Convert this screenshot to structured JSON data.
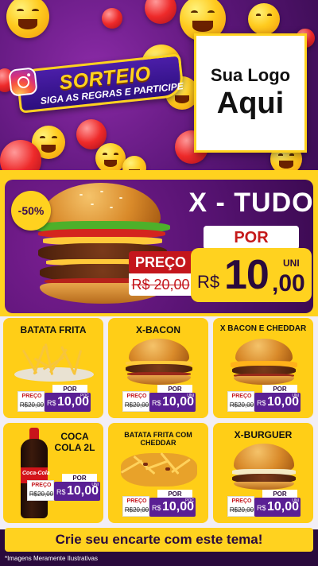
{
  "promo": {
    "title": "SORTEIO",
    "subtitle": "SIGA AS REGRAS E PARTICIPE"
  },
  "logo": {
    "line1": "Sua Logo",
    "line2": "Aqui"
  },
  "featured": {
    "discount": "-50%",
    "name": "X - TUDO",
    "por_label": "POR",
    "preco_label": "PREÇO",
    "old_price": "R$ 20,00",
    "currency": "R$",
    "price_int": "10",
    "price_cents": ",00",
    "unit": "UNI"
  },
  "products": [
    {
      "name": "BATATA FRITA",
      "preco_label": "PREÇO",
      "old_price": "R$20,00",
      "por_label": "POR",
      "currency": "R$",
      "price": "10,00",
      "unit": "POÇ"
    },
    {
      "name": "X-BACON",
      "preco_label": "PREÇO",
      "old_price": "R$20,00",
      "por_label": "POR",
      "currency": "R$",
      "price": "10,00",
      "unit": "UNI"
    },
    {
      "name": "X BACON E CHEDDAR",
      "preco_label": "PREÇO",
      "old_price": "R$20,00",
      "por_label": "POR",
      "currency": "R$",
      "price": "10,00",
      "unit": "UNI"
    },
    {
      "name": "COCA COLA 2L",
      "preco_label": "PREÇO",
      "old_price": "R$20,00",
      "por_label": "POR",
      "currency": "R$",
      "price": "10,00",
      "unit": "UNI",
      "brand": "Coca-Cola"
    },
    {
      "name": "BATATA FRITA COM CHEDDAR",
      "preco_label": "PREÇO",
      "old_price": "R$20,00",
      "por_label": "POR",
      "currency": "R$",
      "price": "10,00",
      "unit": "POÇ"
    },
    {
      "name": "X-BURGUER",
      "preco_label": "PREÇO",
      "old_price": "R$20,00",
      "por_label": "POR",
      "currency": "R$",
      "price": "10,00",
      "unit": "UNI"
    }
  ],
  "cta": "Crie seu encarte com este tema!",
  "footnote": "*Imagens Meramente Ilustrativas",
  "colors": {
    "purple": "#5b1678",
    "yellow": "#ffd21f",
    "red": "#c4161c"
  }
}
